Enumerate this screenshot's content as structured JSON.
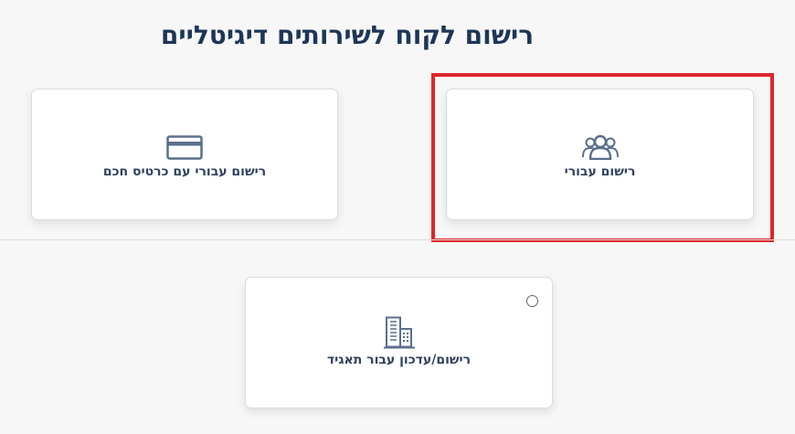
{
  "page": {
    "title": "רישום לקוח לשירותים דיגיטליים"
  },
  "cards": {
    "smart_card": {
      "label": "רישום עבורי עם כרטיס חכם",
      "icon": "credit-card-icon"
    },
    "self": {
      "label": "רישום עבורי",
      "icon": "users-icon"
    },
    "corporation": {
      "label": "רישום/עדכון עבור תאגיד",
      "icon": "building-icon"
    }
  },
  "colors": {
    "background": "#f7f7f7",
    "title": "#1d3658",
    "icon": "#5b6f8c",
    "highlight": "#e0262a"
  }
}
